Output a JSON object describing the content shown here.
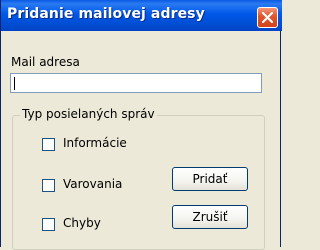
{
  "window": {
    "title": "Pridanie mailovej adresy"
  },
  "form": {
    "mail_label": "Mail adresa",
    "mail_value": ""
  },
  "group": {
    "legend": "Typ posielaných správ",
    "options": [
      {
        "label": "Informácie",
        "checked": false
      },
      {
        "label": "Varovania",
        "checked": false
      },
      {
        "label": "Chyby",
        "checked": false
      }
    ]
  },
  "buttons": {
    "add_label": "Pridať",
    "cancel_label": "Zrušiť"
  },
  "colors": {
    "titlebar": "#0054e3",
    "close": "#e2582e",
    "face": "#ece9d8"
  },
  "icons": {
    "close": "close-icon"
  }
}
